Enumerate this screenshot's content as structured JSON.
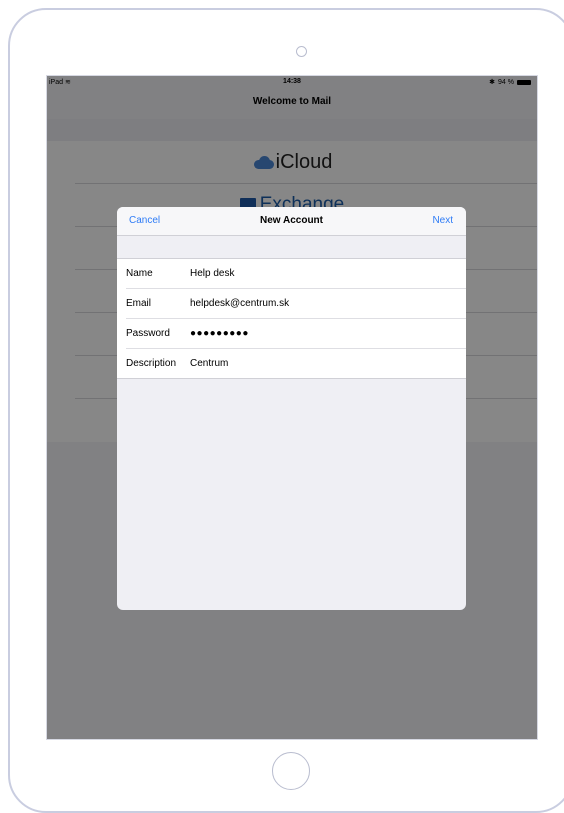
{
  "status_bar": {
    "device": "iPad",
    "time": "14:38",
    "battery": "94 %"
  },
  "background_screen": {
    "title": "Welcome to Mail",
    "providers": [
      "iCloud",
      "Exchange"
    ]
  },
  "modal": {
    "cancel_label": "Cancel",
    "title": "New Account",
    "next_label": "Next",
    "fields": [
      {
        "label": "Name",
        "value": "Help desk"
      },
      {
        "label": "Email",
        "value": "helpdesk@centrum.sk"
      },
      {
        "label": "Password",
        "value": "●●●●●●●●●"
      },
      {
        "label": "Description",
        "value": "Centrum"
      }
    ]
  }
}
